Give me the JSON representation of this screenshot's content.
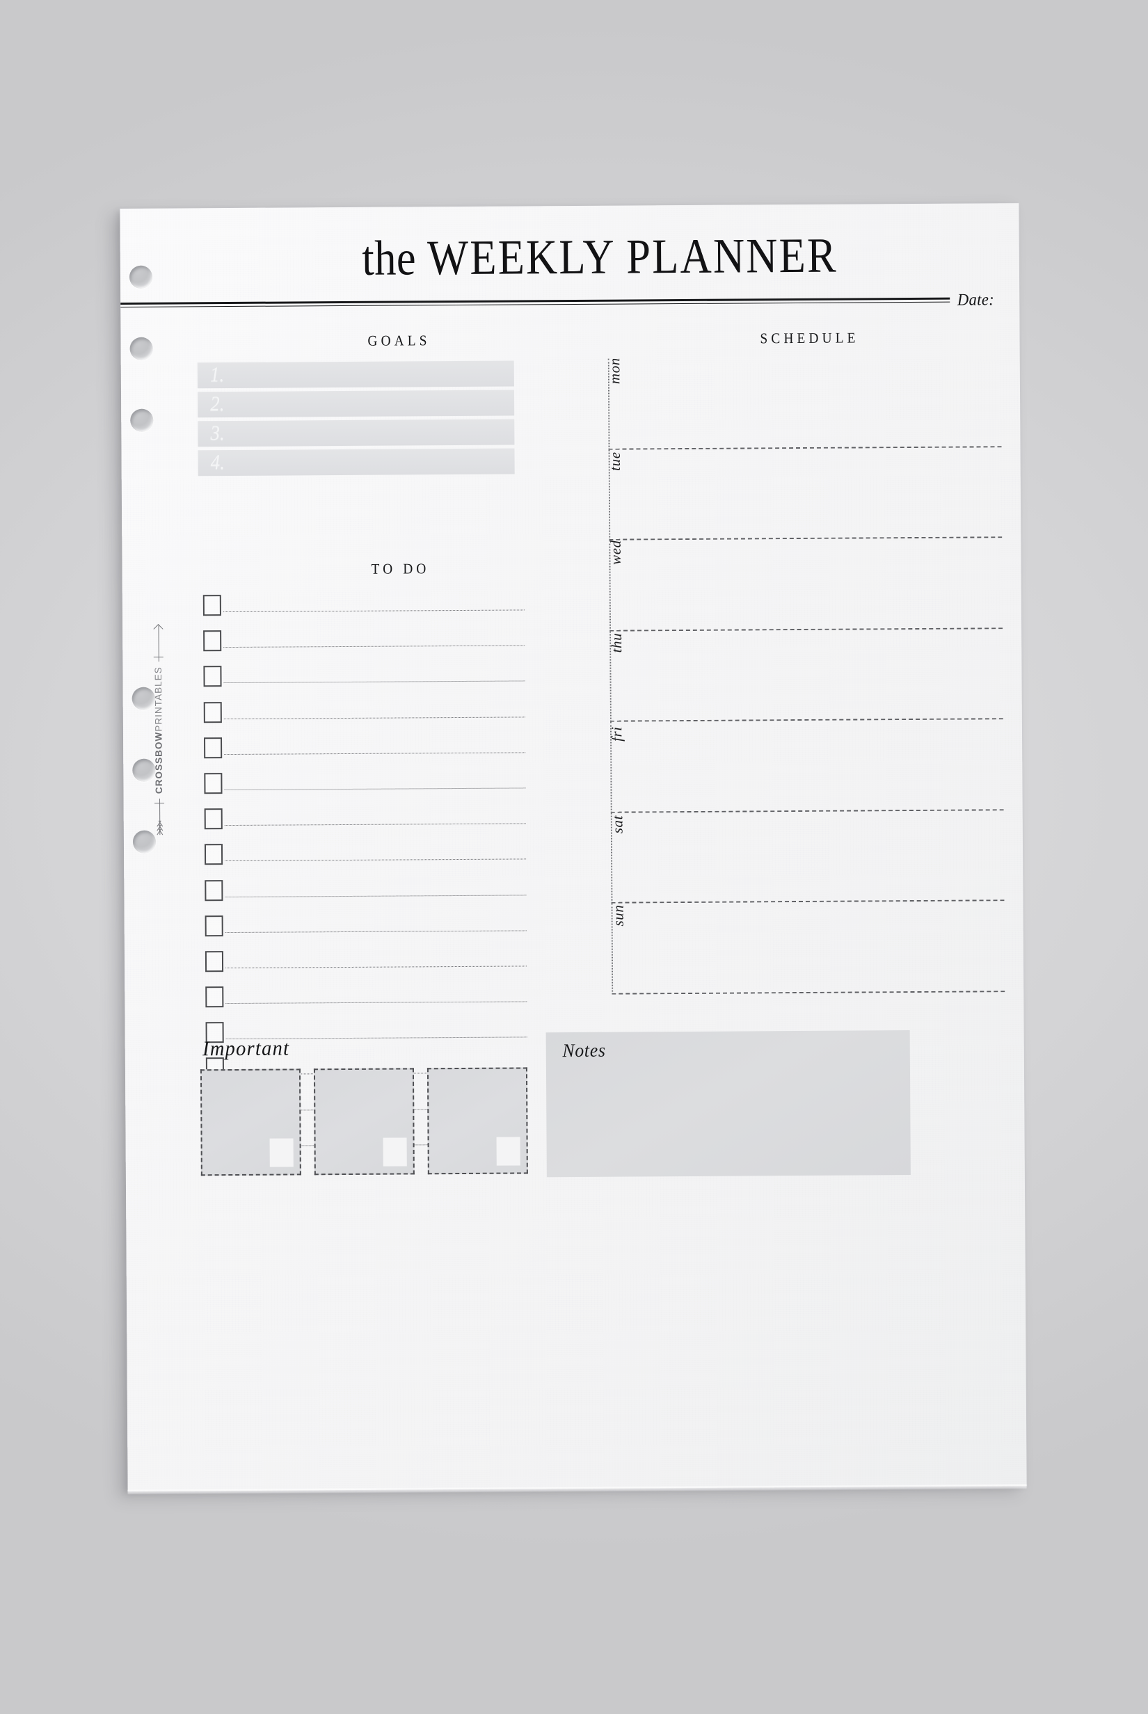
{
  "page": {
    "title_lower": "the",
    "title_upper": "WEEKLY PLANNER",
    "date_label": "Date:"
  },
  "brand": {
    "name_bold": "CROSSBOW",
    "name_light": "PRINTABLES"
  },
  "goals": {
    "heading": "GOALS",
    "items": [
      {
        "num": "1."
      },
      {
        "num": "2."
      },
      {
        "num": "3."
      },
      {
        "num": "4."
      }
    ]
  },
  "todo": {
    "heading": "TO DO",
    "row_count": 16
  },
  "schedule": {
    "heading": "SCHEDULE",
    "days": [
      "mon",
      "tue",
      "wed",
      "thu",
      "fri",
      "sat",
      "sun"
    ]
  },
  "important": {
    "heading": "Important",
    "box_count": 3
  },
  "notes": {
    "label": "Notes"
  },
  "colors": {
    "backdrop": "#d4d4d6",
    "paper": "#f6f6f7",
    "ink": "#17181a",
    "fill_gray": "#dcdde0",
    "goal_bar": "#e1e2e5",
    "dotted_line": "#6a6b6f"
  },
  "holes": {
    "count": 6,
    "positions": [
      82,
      185,
      288,
      688,
      791,
      894
    ]
  }
}
